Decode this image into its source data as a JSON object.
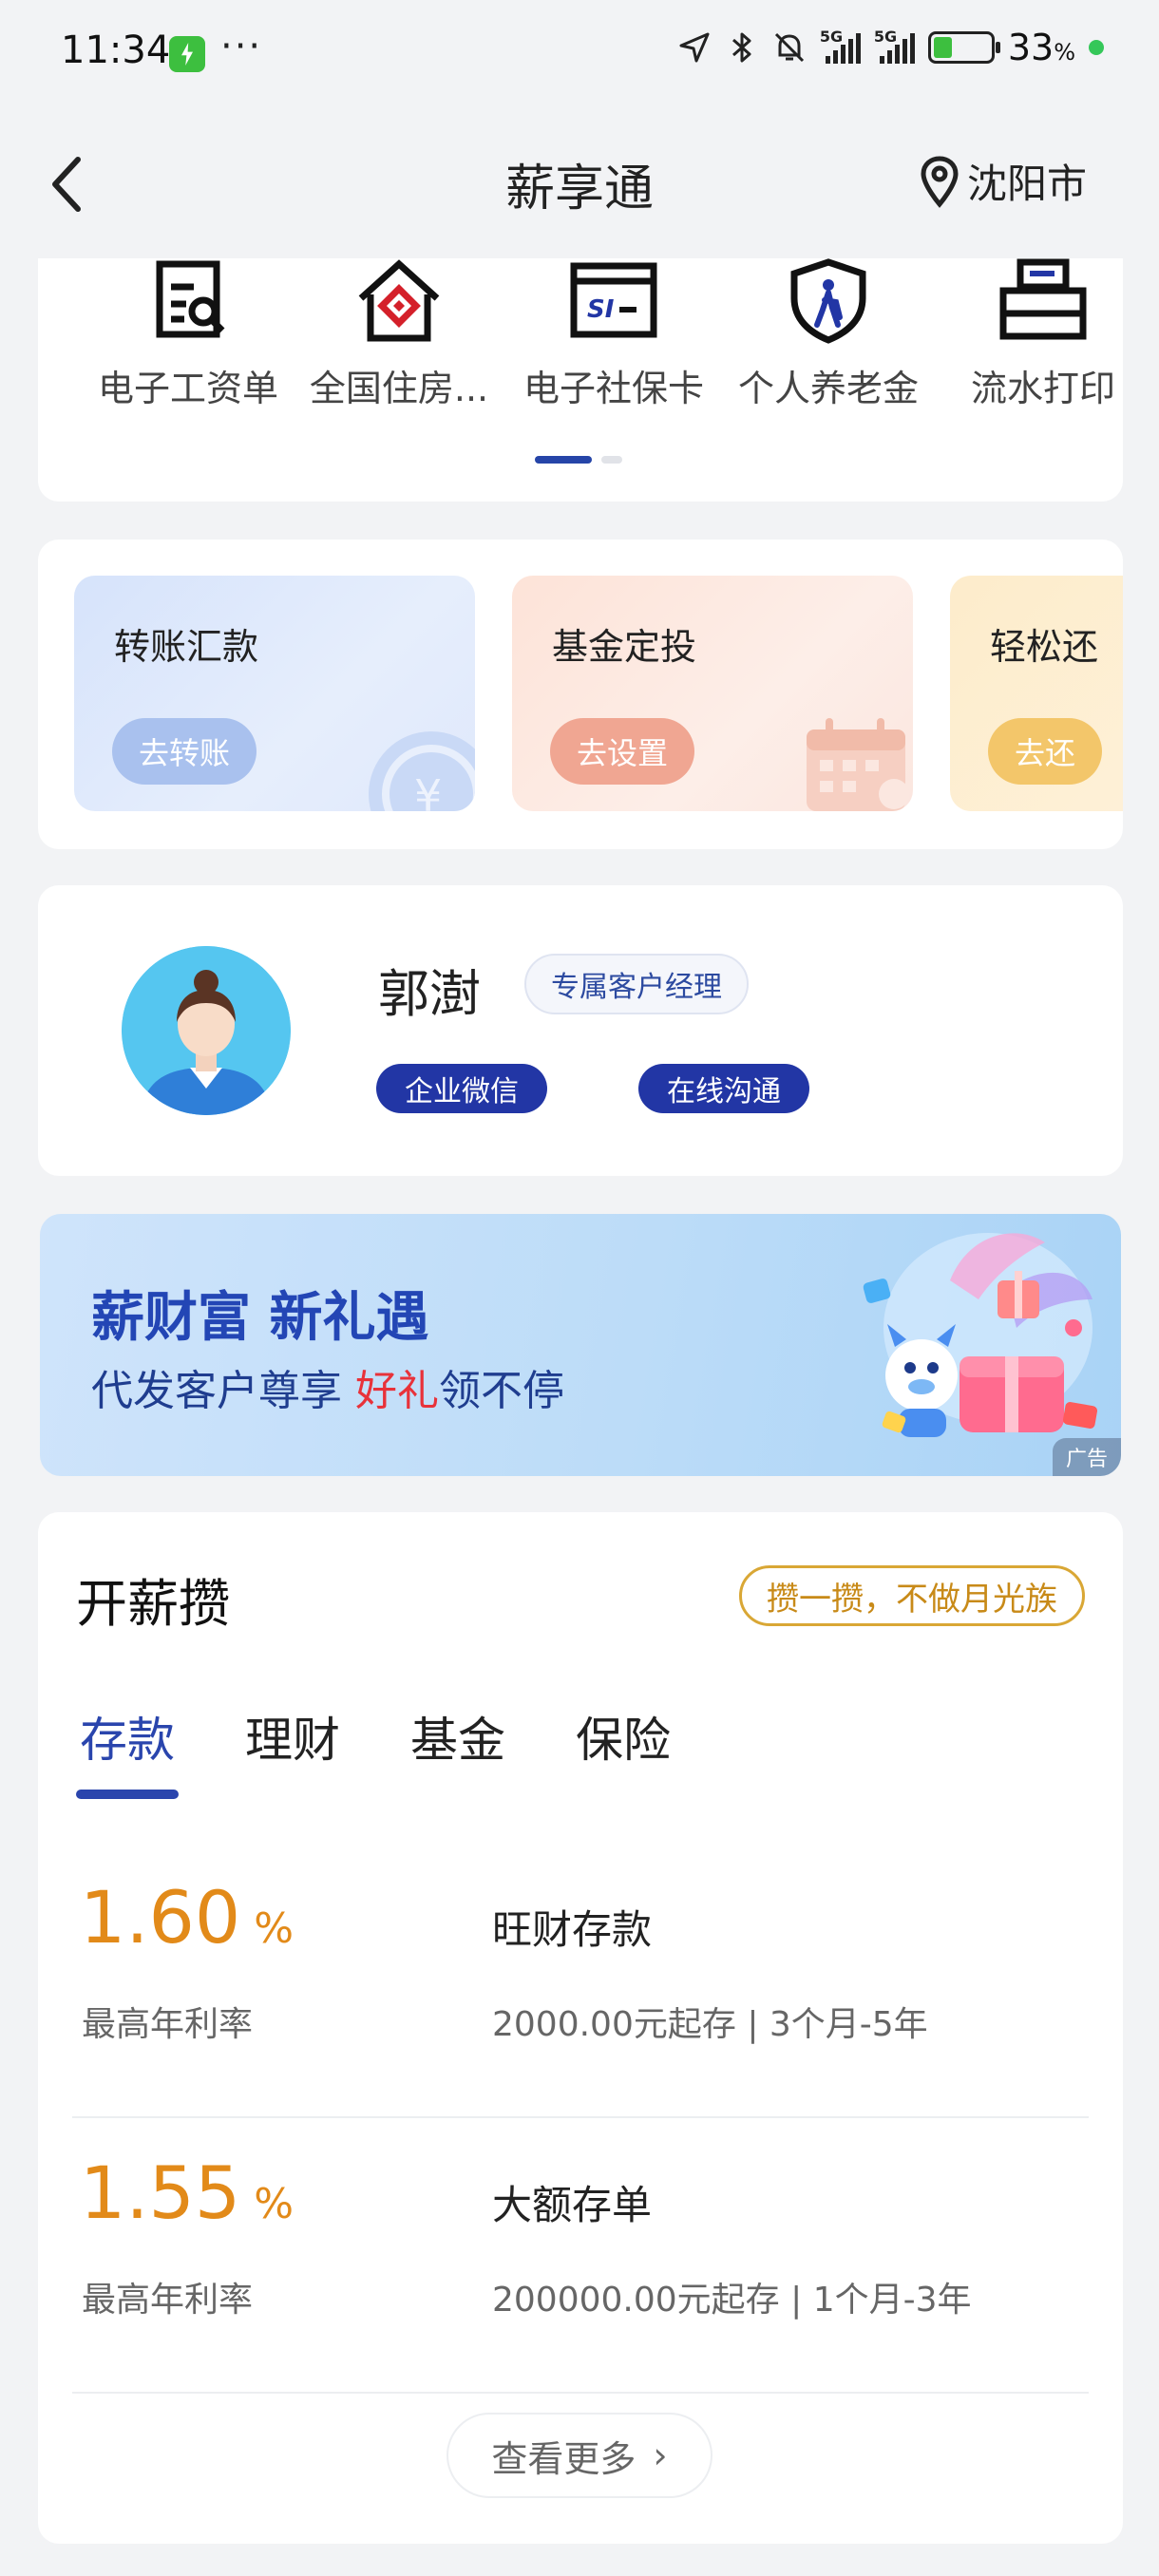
{
  "status_bar": {
    "time": "11:34",
    "overflow": "···",
    "network": "5G",
    "battery_percent": "33",
    "battery_unit": "%",
    "battery_level": 0.33,
    "icons": [
      "charging-app-icon",
      "location-arrow-icon",
      "bluetooth-icon",
      "mute-bell-icon",
      "signal-icon",
      "battery-icon"
    ]
  },
  "nav": {
    "title": "薪享通",
    "city": "沈阳市",
    "back_icon": "chevron-left-icon",
    "location_icon": "map-pin-icon"
  },
  "services": {
    "items": [
      {
        "label": "电子工资单",
        "icon": "payslip-icon"
      },
      {
        "label": "全国住房...",
        "icon": "housing-fund-icon"
      },
      {
        "label": "电子社保卡",
        "icon": "social-security-card-icon"
      },
      {
        "label": "个人养老金",
        "icon": "pension-shield-icon"
      },
      {
        "label": "流水打印",
        "icon": "printer-icon"
      }
    ],
    "page_count": 2,
    "active_page": 1
  },
  "quick_actions": [
    {
      "title": "转账汇款",
      "button": "去转账",
      "color": "#a9c1ee"
    },
    {
      "title": "基金定投",
      "button": "去设置",
      "color": "#f0a692"
    },
    {
      "title": "轻松还",
      "button": "去还",
      "color": "#f3c66a"
    }
  ],
  "manager": {
    "name": "郭澍",
    "role": "专属客户经理",
    "wechat_button": "企业微信",
    "chat_button": "在线沟通"
  },
  "banner": {
    "title": "薪财富 新礼遇",
    "subtitle_prefix": "代发客户尊享 ",
    "subtitle_highlight": "好礼",
    "subtitle_suffix": "领不停",
    "ad_label": "广告"
  },
  "savings": {
    "title": "开薪攒",
    "slogan": "攒一攒，不做月光族",
    "tabs": [
      "存款",
      "理财",
      "基金",
      "保险"
    ],
    "active_tab": 0,
    "products": [
      {
        "rate": "1.60",
        "rate_unit": "%",
        "rate_label": "最高年利率",
        "name": "旺财存款",
        "desc": "2000.00元起存 | 3个月-5年"
      },
      {
        "rate": "1.55",
        "rate_unit": "%",
        "rate_label": "最高年利率",
        "name": "大额存单",
        "desc": "200000.00元起存 | 1个月-3年"
      }
    ],
    "more_button": "查看更多",
    "more_arrow": "›"
  },
  "colors": {
    "brand_blue": "#2236a5",
    "rate_orange": "#e28a19",
    "slogan_gold": "#d9a735",
    "highlight_red": "#e8323a"
  }
}
